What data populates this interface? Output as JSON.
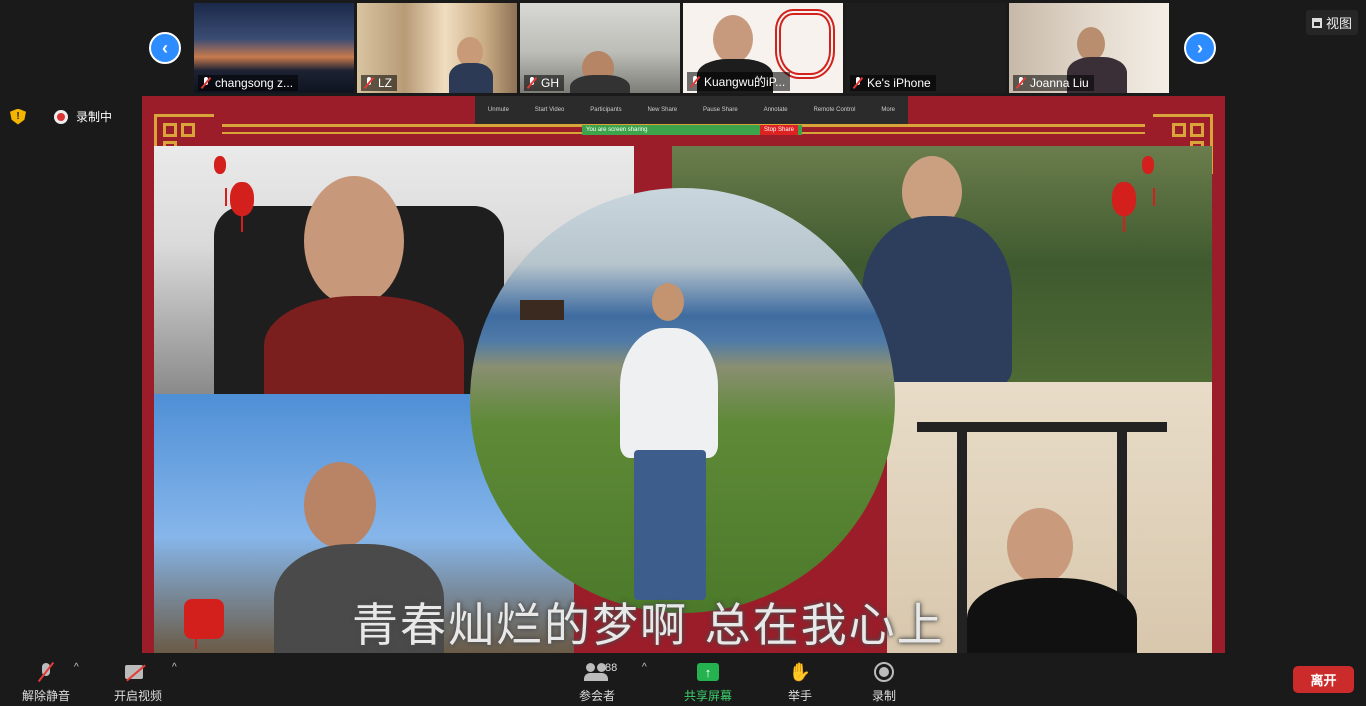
{
  "participants": [
    {
      "name": "changsong z...",
      "muted": true
    },
    {
      "name": "LZ",
      "muted": true
    },
    {
      "name": "GH",
      "muted": true
    },
    {
      "name": "Kuangwu的iP...",
      "muted": true
    },
    {
      "name": "Ke's iPhone",
      "muted": true
    },
    {
      "name": "Joanna Liu",
      "muted": true
    }
  ],
  "nav": {
    "prev": "‹",
    "next": "›"
  },
  "view_button": {
    "label": "视图"
  },
  "recording": {
    "label": "录制中",
    "shield_glyph": "!"
  },
  "shared_screen": {
    "subtitle": "青春灿烂的梦啊 总在我心上",
    "mini_toolbar": [
      "Unmute",
      "Start Video",
      "Participants",
      "New Share",
      "Pause Share",
      "Annotate",
      "Remote Control",
      "More"
    ],
    "mini_share_text": "You are screen sharing",
    "mini_stop": "Stop Share"
  },
  "controls": {
    "mute_label": "解除静音",
    "video_label": "开启视频",
    "participants_label": "参会者",
    "participants_count": "88",
    "share_label": "共享屏幕",
    "raise_hand_label": "举手",
    "record_label": "录制",
    "leave_label": "离开",
    "caret": "^",
    "share_glyph": "↑",
    "hand_glyph": "✋"
  },
  "colors": {
    "accent": "#2d8cff",
    "leave": "#cc2b2b",
    "share": "#24b34f",
    "frame": "#9c1d2a",
    "gold": "#d9a53b"
  }
}
